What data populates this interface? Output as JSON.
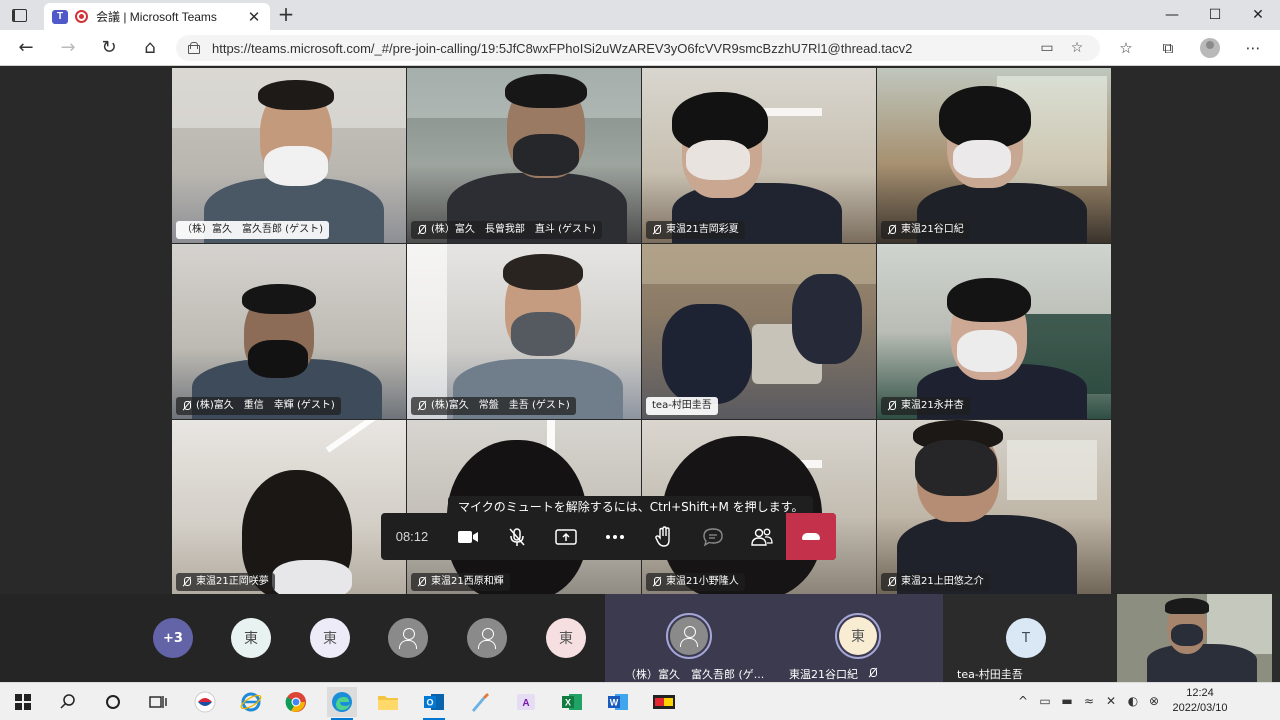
{
  "browser": {
    "tab_title": "会議 | Microsoft Teams",
    "tab_close": "✕",
    "new_tab": "+",
    "url": "https://teams.microsoft.com/_#/pre-join-calling/19:5JfC8wxFPhoISi2uWzAREV3yO6fcVVR9smcBzzhU7Rl1@thread.tacv2",
    "window_controls": [
      "—",
      "☐",
      "✕"
    ],
    "nav": {
      "back": "←",
      "forward": "→",
      "reload": "↻",
      "home": "⌂"
    }
  },
  "meeting": {
    "tiles": [
      {
        "name": "（株）富久　富久吾郎 (ゲスト)",
        "style": "light"
      },
      {
        "name": "(株）富久　長曾我部　直斗 (ゲスト)",
        "style": "dark"
      },
      {
        "name": "東温21吉岡彩夏",
        "style": "dark"
      },
      {
        "name": "東温21谷口紀",
        "style": "dark"
      },
      {
        "name": "(株)富久　重信　幸輝 (ゲスト)",
        "style": "dark"
      },
      {
        "name": "(株)富久　常盤　圭吾 (ゲスト)",
        "style": "dark"
      },
      {
        "name": "tea-村田圭吾",
        "style": "light"
      },
      {
        "name": "東温21永井杏",
        "style": "dark"
      },
      {
        "name": "東温21正岡咲夢",
        "style": "dark"
      },
      {
        "name": "東温21西原和輝",
        "style": "dark"
      },
      {
        "name": "東温21小野隆人",
        "style": "dark"
      },
      {
        "name": "東温21上田悠之介",
        "style": "dark"
      }
    ],
    "tooltip": "マイクのミュートを解除するには、Ctrl+Shift+M を押します。",
    "timer": "08:12",
    "controls": {
      "camera_icon": "camera-icon",
      "mic_icon": "mic-off-icon",
      "share_icon": "share-tray-icon",
      "more_icon": "more-icon",
      "raise_hand_icon": "raise-hand-icon",
      "chat_icon": "chat-icon",
      "people_icon": "people-icon",
      "hangup_icon": "hang-up-icon"
    }
  },
  "strip": {
    "overflow_count": "+3",
    "avatars": [
      {
        "initial": "東",
        "color": "#e8f3f1"
      },
      {
        "initial": "東",
        "color": "#ecebf7"
      },
      {
        "initial": "",
        "color": "#8a8a8a"
      },
      {
        "initial": "",
        "color": "#8a8a8a"
      },
      {
        "initial": "東",
        "color": "#f5dfe0"
      }
    ],
    "card1": {
      "name": "（株）富久　富久吾郎 (ゲ..."
    },
    "card2": {
      "name": "東温21谷口紀",
      "initial": "東"
    },
    "card3": {
      "name": "tea-村田圭吾",
      "initial": "T"
    }
  },
  "taskbar": {
    "time": "12:24",
    "date": "2022/03/10"
  }
}
